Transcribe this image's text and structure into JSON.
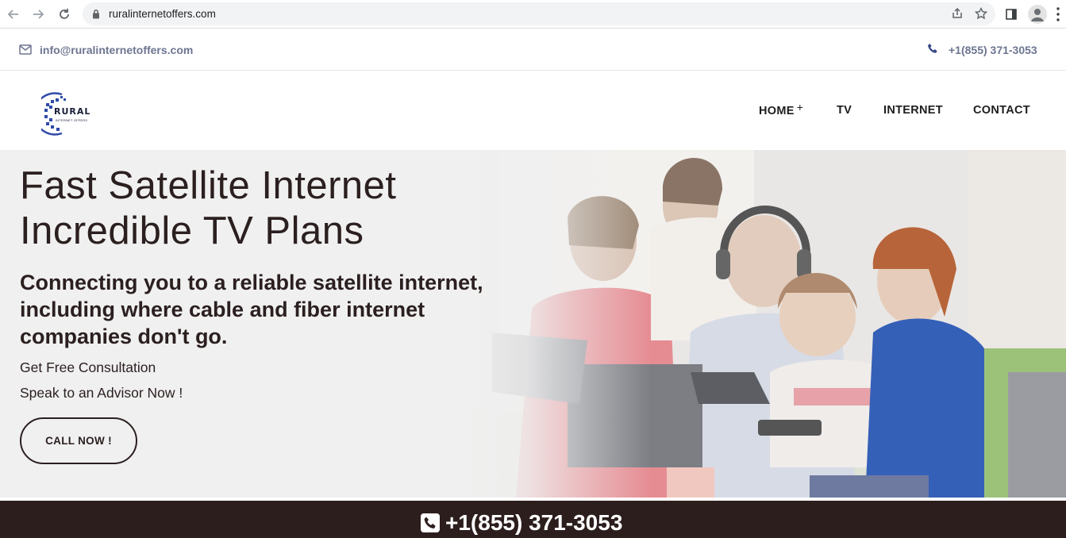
{
  "browser": {
    "url": "ruralinternetoffers.com"
  },
  "topbar": {
    "email": "info@ruralinternetoffers.com",
    "phone": "+1(855) 371-3053"
  },
  "logo": {
    "title": "RURAL",
    "subtitle": "INTERNET OFFERS"
  },
  "nav": {
    "home": "HOME",
    "home_plus": "+",
    "tv": "TV",
    "internet": "INTERNET",
    "contact": "CONTACT"
  },
  "hero": {
    "headline_1": "Fast Satellite Internet",
    "headline_2": "Incredible TV Plans",
    "subheadline": "Connecting you to a reliable satellite internet, including where cable and fiber internet companies don't go.",
    "line_1": "Get Free Consultation",
    "line_2": "Speak to an Advisor Now !",
    "cta": "CALL NOW !"
  },
  "bottombar": {
    "phone": "+1(855) 371-3053"
  },
  "colors": {
    "hero_bg": "#f0f0f0",
    "bottom_bar": "#2d1e1e",
    "topbar_text": "#6d7591",
    "dark_text": "#2b1f1f"
  }
}
